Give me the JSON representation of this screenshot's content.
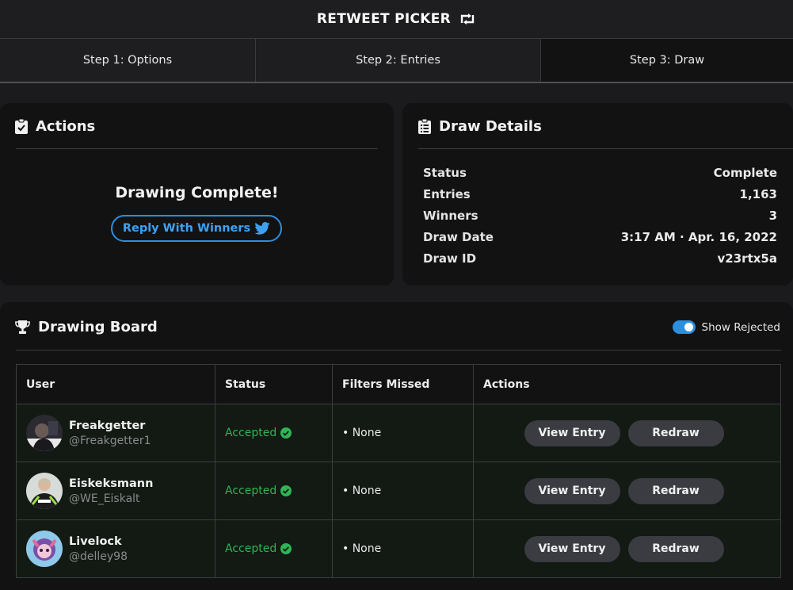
{
  "header": {
    "title": "RETWEET PICKER",
    "icon": "retweet-icon"
  },
  "steps": [
    {
      "label": "Step 1: Options",
      "active": false
    },
    {
      "label": "Step 2: Entries",
      "active": false
    },
    {
      "label": "Step 3: Draw",
      "active": true
    }
  ],
  "actions_card": {
    "title": "Actions",
    "icon": "clipboard-check-icon",
    "message": "Drawing Complete!",
    "reply_button": "Reply With Winners",
    "reply_icon": "twitter-bird-icon"
  },
  "details_card": {
    "title": "Draw Details",
    "icon": "clipboard-list-icon",
    "rows": [
      {
        "label": "Status",
        "value": "Complete"
      },
      {
        "label": "Entries",
        "value": "1,163"
      },
      {
        "label": "Winners",
        "value": "3"
      },
      {
        "label": "Draw Date",
        "value": "3:17 AM · Apr. 16, 2022"
      },
      {
        "label": "Draw ID",
        "value": "v23rtx5a"
      }
    ]
  },
  "board": {
    "title": "Drawing Board",
    "icon": "trophy-icon",
    "toggle_label": "Show Rejected",
    "toggle_on": true,
    "columns": [
      "User",
      "Status",
      "Filters Missed",
      "Actions"
    ],
    "view_label": "View Entry",
    "redraw_label": "Redraw",
    "rows": [
      {
        "name": "Freakgetter",
        "handle": "@Freakgetter1",
        "status": "Accepted",
        "filters": "• None"
      },
      {
        "name": "Eiskeksmann",
        "handle": "@WE_Eiskalt",
        "status": "Accepted",
        "filters": "• None"
      },
      {
        "name": "Livelock",
        "handle": "@delley98",
        "status": "Accepted",
        "filters": "• None"
      }
    ]
  },
  "colors": {
    "accent": "#2b8fe0",
    "accepted": "#30b455",
    "background": "#1b1b1d",
    "card": "#121213"
  }
}
